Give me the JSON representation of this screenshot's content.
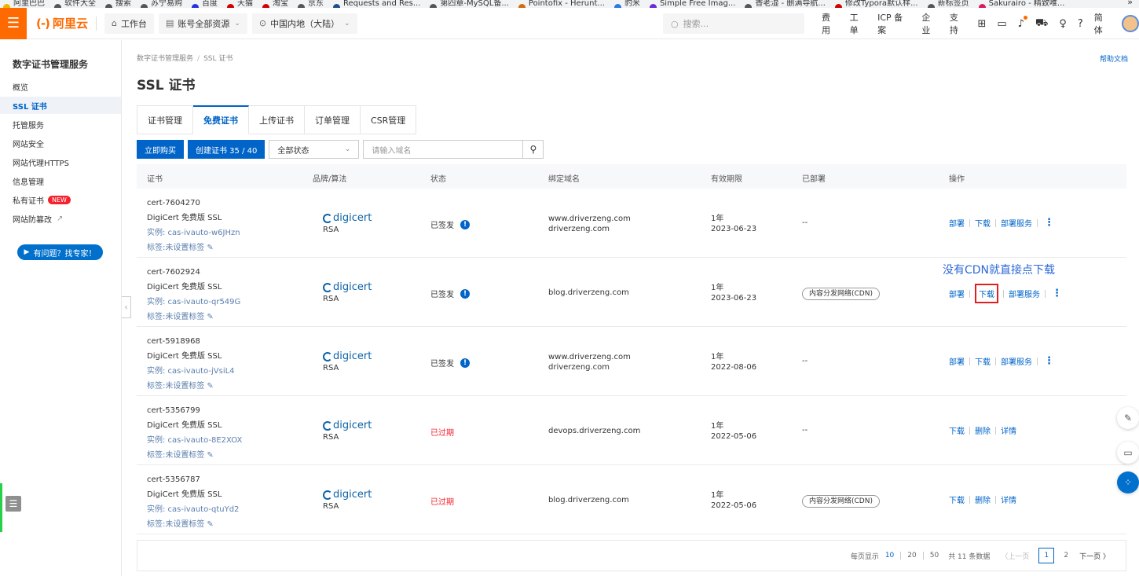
{
  "bookmarks": [
    {
      "label": "阿里巴巴",
      "color": "#f0b400"
    },
    {
      "label": "软件大全",
      "color": "#555555"
    },
    {
      "label": "搜索",
      "color": "#555555"
    },
    {
      "label": "苏宁易购",
      "color": "#555555"
    },
    {
      "label": "百度",
      "color": "#2932e1"
    },
    {
      "label": "天猫",
      "color": "#d30000"
    },
    {
      "label": "淘宝",
      "color": "#d30000"
    },
    {
      "label": "京东",
      "color": "#555555"
    },
    {
      "label": "Requests and Res...",
      "color": "#1f4e8c"
    },
    {
      "label": "第四章-MySQL备...",
      "color": "#555555"
    },
    {
      "label": "Pointofix - Herunt...",
      "color": "#d46b08"
    },
    {
      "label": "豹米",
      "color": "#2a7be4"
    },
    {
      "label": "Simple Free Imag...",
      "color": "#6a2bd8"
    },
    {
      "label": "香老湿 - 删满导航...",
      "color": "#555555"
    },
    {
      "label": "修改Typora默认样...",
      "color": "#d30000"
    },
    {
      "label": "新标签页",
      "color": "#555555"
    },
    {
      "label": "Sakurairo - 精致唯...",
      "color": "#d81b60"
    }
  ],
  "bookmarks_more": "»",
  "topnav": {
    "logo_text": "阿里云",
    "logo_bracket": "(-)",
    "workbench": "工作台",
    "account_resources": "账号全部资源",
    "region": "中国内地（大陆）",
    "search_placeholder": "搜索...",
    "links": [
      "费用",
      "工单",
      "ICP 备案",
      "企业",
      "支持"
    ],
    "lang": "简体"
  },
  "sidebar": {
    "title": "数字证书管理服务",
    "items": [
      {
        "label": "概览"
      },
      {
        "label": "SSL 证书"
      },
      {
        "label": "托管服务"
      },
      {
        "label": "网站安全"
      },
      {
        "label": "网站代理HTTPS"
      },
      {
        "label": "信息管理"
      },
      {
        "label": "私有证书"
      },
      {
        "label": "网站防篡改"
      }
    ],
    "new_badge": "NEW",
    "expert_button": "有问题？找专家！"
  },
  "breadcrumb": [
    "数字证书管理服务",
    "SSL 证书"
  ],
  "help_link": "帮助文档",
  "page_title": "SSL 证书",
  "tabs": [
    "证书管理",
    "免费证书",
    "上传证书",
    "订单管理",
    "CSR管理"
  ],
  "active_tab": 1,
  "toolbar": {
    "buy_now": "立即购买",
    "create_cert": "创建证书 35 / 40",
    "status_select": "全部状态",
    "domain_placeholder": "请输入域名"
  },
  "table": {
    "headers": [
      "证书",
      "品牌/算法",
      "状态",
      "绑定域名",
      "有效期限",
      "已部署",
      "操作"
    ],
    "rows": [
      {
        "id": "cert-7604270",
        "name": "DigiCert 免费版 SSL",
        "instance": "实例: cas-ivauto-w6JHzn",
        "tag": "标签:未设置标签",
        "brand": "digicert",
        "algo": "RSA",
        "status": "已签发",
        "expired": false,
        "domains": [
          "www.driverzeng.com",
          "driverzeng.com"
        ],
        "validity": "1年",
        "date": "2023-06-23",
        "deployed": "--",
        "actions": [
          "部署",
          "下载",
          "部署服务"
        ],
        "has_more": true
      },
      {
        "id": "cert-7602924",
        "name": "DigiCert 免费版 SSL",
        "instance": "实例: cas-ivauto-qr549G",
        "tag": "标签:未设置标签",
        "brand": "digicert",
        "algo": "RSA",
        "status": "已签发",
        "expired": false,
        "domains": [
          "blog.driverzeng.com"
        ],
        "validity": "1年",
        "date": "2023-06-23",
        "deployed": "内容分发网络(CDN)",
        "actions": [
          "部署",
          "下载",
          "部署服务"
        ],
        "has_more": true
      },
      {
        "id": "cert-5918968",
        "name": "DigiCert 免费版 SSL",
        "instance": "实例: cas-ivauto-jVsiL4",
        "tag": "标签:未设置标签",
        "brand": "digicert",
        "algo": "RSA",
        "status": "已签发",
        "expired": false,
        "domains": [
          "www.driverzeng.com",
          "driverzeng.com"
        ],
        "validity": "1年",
        "date": "2022-08-06",
        "deployed": "--",
        "actions": [
          "部署",
          "下载",
          "部署服务"
        ],
        "has_more": true
      },
      {
        "id": "cert-5356799",
        "name": "DigiCert 免费版 SSL",
        "instance": "实例: cas-ivauto-8E2XOX",
        "tag": "标签:未设置标签",
        "brand": "digicert",
        "algo": "RSA",
        "status": "已过期",
        "expired": true,
        "domains": [
          "devops.driverzeng.com"
        ],
        "validity": "1年",
        "date": "2022-05-06",
        "deployed": "--",
        "actions": [
          "下载",
          "删除",
          "详情"
        ],
        "has_more": false
      },
      {
        "id": "cert-5356787",
        "name": "DigiCert 免费版 SSL",
        "instance": "实例: cas-ivauto-qtuYd2",
        "tag": "标签:未设置标签",
        "brand": "digicert",
        "algo": "RSA",
        "status": "已过期",
        "expired": true,
        "domains": [
          "blog.driverzeng.com"
        ],
        "validity": "1年",
        "date": "2022-05-06",
        "deployed": "内容分发网络(CDN)",
        "actions": [
          "下载",
          "删除",
          "详情"
        ],
        "has_more": false
      }
    ]
  },
  "annotation": "没有CDN就直接点下载",
  "pagination": {
    "per_page_label": "每页显示",
    "sizes": [
      "10",
      "20",
      "50"
    ],
    "current_size": "10",
    "total": "共 11 条数据",
    "prev": "〈上一页",
    "pages": [
      "1",
      "2"
    ],
    "current_page": "1",
    "next": "下一页 〉"
  },
  "colors": {
    "brand_orange": "#ff6a00",
    "primary_blue": "#0064c8",
    "expired_red": "#f5222d",
    "highlight_red": "#e02020"
  }
}
